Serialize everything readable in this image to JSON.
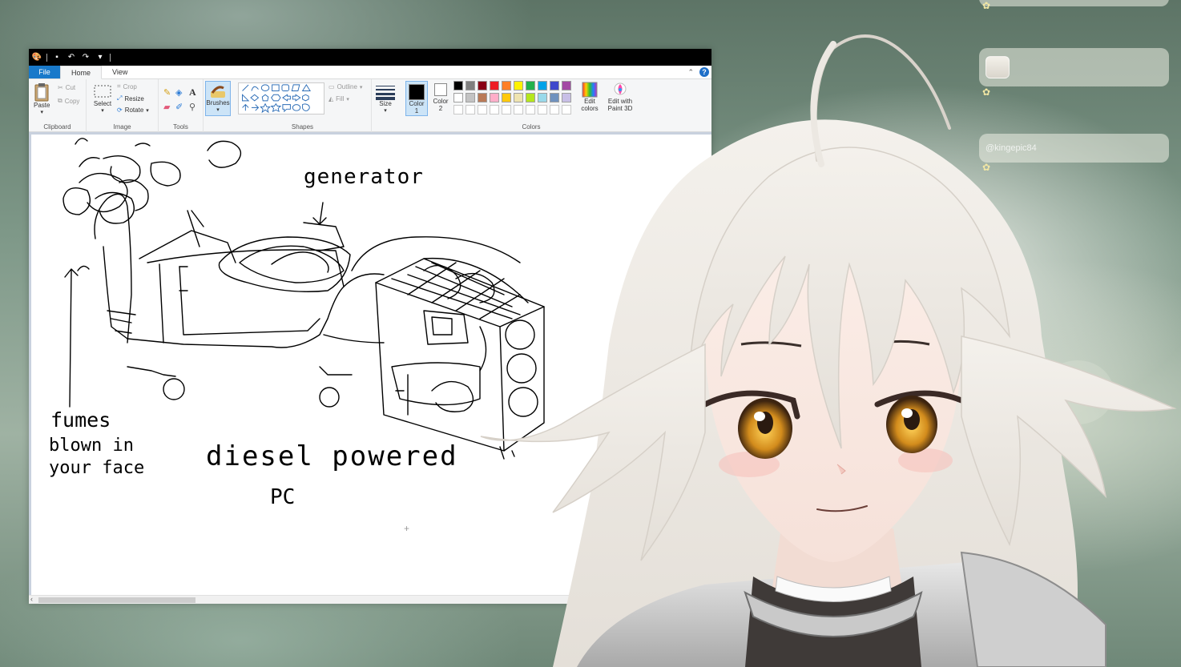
{
  "app": {
    "menu_tabs": {
      "file": "File",
      "home": "Home",
      "view": "View"
    },
    "help_label": "?"
  },
  "ribbon": {
    "clipboard": {
      "label": "Clipboard",
      "paste": "Paste",
      "cut": "Cut",
      "copy": "Copy"
    },
    "image": {
      "label": "Image",
      "select": "Select",
      "crop": "Crop",
      "resize": "Resize",
      "rotate": "Rotate"
    },
    "tools": {
      "label": "Tools"
    },
    "brushes": {
      "label": "Brushes"
    },
    "shapes": {
      "label": "Shapes",
      "outline": "Outline",
      "fill": "Fill"
    },
    "size": {
      "label": "Size"
    },
    "colors": {
      "label": "Colors",
      "color1": "Color\n1",
      "color2": "Color\n2",
      "edit_colors": "Edit\ncolors",
      "edit_with": "Edit with\nPaint 3D",
      "color1_value": "#000000",
      "color2_value": "#ffffff",
      "palette_row1": [
        "#000000",
        "#7f7f7f",
        "#880015",
        "#ed1c24",
        "#ff7f27",
        "#fff200",
        "#22b14c",
        "#00a2e8",
        "#3f48cc",
        "#a349a4"
      ],
      "palette_row2": [
        "#ffffff",
        "#c3c3c3",
        "#b97a57",
        "#ffaec9",
        "#ffc90e",
        "#efe4b0",
        "#b5e61d",
        "#99d9ea",
        "#7092be",
        "#c8bfe7"
      ],
      "palette_row3": [
        "#ffffff",
        "#ffffff",
        "#ffffff",
        "#ffffff",
        "#ffffff",
        "#ffffff",
        "#ffffff",
        "#ffffff",
        "#ffffff",
        "#ffffff"
      ]
    }
  },
  "drawing": {
    "label_generator": "generator",
    "label_fumes_1": "fumes",
    "label_fumes_2": "blown in",
    "label_fumes_3": "your face",
    "label_title_1": "diesel powered",
    "label_title_2": "PC"
  },
  "chat": {
    "messages": [
      {
        "user": ""
      },
      {
        "user": ""
      },
      {
        "user": "@kingepic84"
      }
    ]
  }
}
